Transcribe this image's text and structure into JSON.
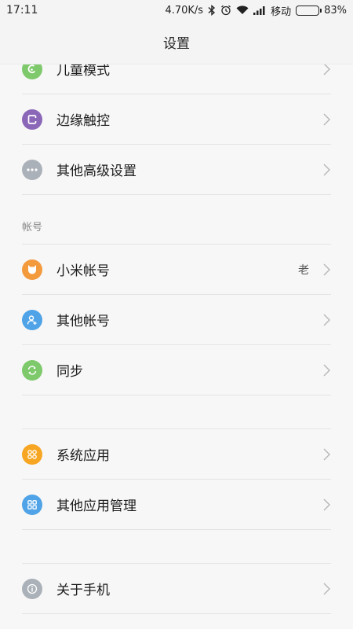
{
  "status_bar": {
    "time": "17:11",
    "net_speed": "4.70K/s",
    "carrier": "移动",
    "battery_text": "83%",
    "battery_level": 0.83,
    "icons": [
      "bluetooth-icon",
      "alarm-icon",
      "wifi-icon",
      "signal-icon",
      "battery-icon"
    ]
  },
  "title": "设置",
  "colors": {
    "kids_mode": "#7dc96b",
    "edge_touch": "#8b67b8",
    "more_settings": "#aab1b8",
    "mi_account": "#f39a3d",
    "other_accounts": "#4fa3e6",
    "sync": "#7dc96b",
    "system_apps": "#f6a623",
    "other_app_mgmt": "#4fa3e6",
    "about_phone": "#aab1b8"
  },
  "rows_top": [
    {
      "label": "儿童模式",
      "icon": "kids-mode-icon"
    },
    {
      "label": "边缘触控",
      "icon": "edge-touch-icon"
    },
    {
      "label": "其他高级设置",
      "icon": "more-dots-icon"
    }
  ],
  "section_account": {
    "header": "帐号",
    "rows": [
      {
        "label": "小米帐号",
        "value": "老",
        "icon": "mi-account-icon"
      },
      {
        "label": "其他帐号",
        "icon": "add-user-icon"
      },
      {
        "label": "同步",
        "icon": "sync-icon"
      }
    ]
  },
  "section_apps": {
    "rows": [
      {
        "label": "系统应用",
        "icon": "system-apps-icon"
      },
      {
        "label": "其他应用管理",
        "icon": "app-grid-icon"
      }
    ]
  },
  "section_about": {
    "rows": [
      {
        "label": "关于手机",
        "icon": "info-icon"
      }
    ]
  }
}
